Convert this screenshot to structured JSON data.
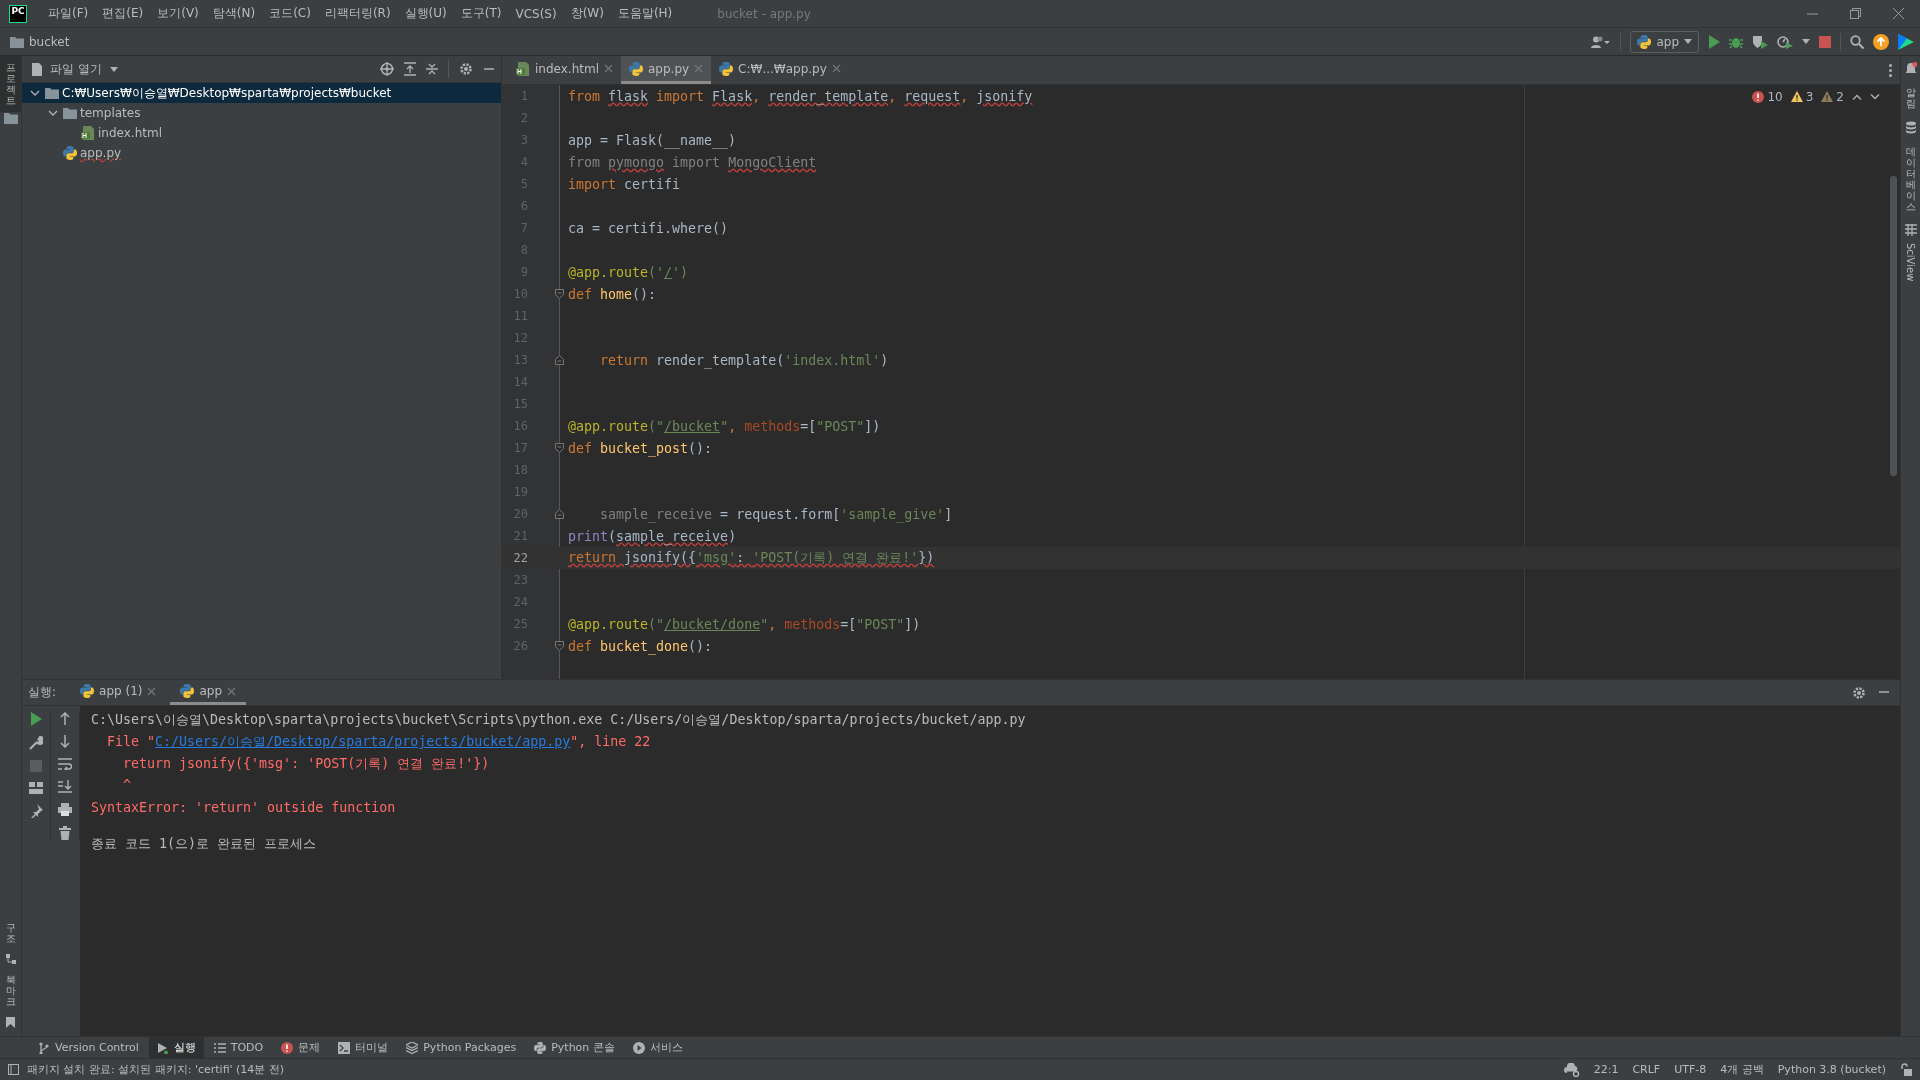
{
  "window": {
    "title": "bucket - app.py",
    "logo": "PC"
  },
  "menu": [
    "파일(F)",
    "편집(E)",
    "보기(V)",
    "탐색(N)",
    "코드(C)",
    "리팩터링(R)",
    "실행(U)",
    "도구(T)",
    "VCS(S)",
    "창(W)",
    "도움말(H)"
  ],
  "breadcrumb": "bucket",
  "run_config": "app",
  "left_strip": {
    "top": "프로젝트",
    "bottom": [
      "구조",
      "북마크"
    ]
  },
  "right_strip": [
    {
      "label": "알림",
      "kind": "bell"
    },
    {
      "label": "데이터베이스",
      "kind": "database"
    },
    {
      "label": "SciView",
      "kind": "grid"
    }
  ],
  "project": {
    "title": "파일 열기",
    "tree": [
      {
        "label": "C:₩Users₩이승열₩Desktop₩sparta₩projects₩bucket",
        "kind": "folder",
        "expanded": true,
        "selected": true,
        "children": [
          {
            "label": "templates",
            "kind": "folder",
            "expanded": true,
            "selected": false,
            "children": [
              {
                "label": "index.html",
                "kind": "html",
                "selected": false
              }
            ]
          },
          {
            "label": "app.py",
            "kind": "python",
            "selected": false
          }
        ]
      }
    ]
  },
  "editor": {
    "tabs": [
      {
        "label": "index.html",
        "kind": "html",
        "selected": false
      },
      {
        "label": "app.py",
        "kind": "python",
        "selected": true
      },
      {
        "label": "C:₩...₩app.py",
        "kind": "python",
        "selected": false
      }
    ],
    "inspections": [
      {
        "kind": "error",
        "count": "10"
      },
      {
        "kind": "warning",
        "count": "3"
      },
      {
        "kind": "weak_warning",
        "count": "2"
      }
    ],
    "lines": [
      {
        "number": "1",
        "current": false,
        "kind": "code",
        "tokens": [
          {
            "text": "from ",
            "kind": "keyword"
          },
          {
            "text": "flask",
            "kind": "plain",
            "error": true
          },
          {
            "text": " import ",
            "kind": "keyword"
          },
          {
            "text": "Flask",
            "kind": "plain",
            "error": true
          },
          {
            "text": ", ",
            "kind": "keyword"
          },
          {
            "text": "render_template",
            "kind": "plain",
            "error": true
          },
          {
            "text": ", ",
            "kind": "keyword"
          },
          {
            "text": "request",
            "kind": "plain",
            "error": true
          },
          {
            "text": ", ",
            "kind": "keyword"
          },
          {
            "text": "jsonify",
            "kind": "plain",
            "error": true
          }
        ]
      },
      {
        "number": "2",
        "current": false,
        "kind": "code"
      },
      {
        "number": "3",
        "current": false,
        "kind": "code",
        "tokens": [
          {
            "text": "app = Flask(__name__)",
            "kind": "plain"
          }
        ]
      },
      {
        "number": "4",
        "current": false,
        "kind": "code",
        "tokens": [
          {
            "text": "from ",
            "kind": "unused"
          },
          {
            "text": "pymongo",
            "kind": "unused",
            "error": true
          },
          {
            "text": " import ",
            "kind": "unused"
          },
          {
            "text": "MongoClient",
            "kind": "unused",
            "error": true
          }
        ]
      },
      {
        "number": "5",
        "current": false,
        "kind": "code",
        "tokens": [
          {
            "text": "import",
            "kind": "keyword"
          },
          {
            "text": " certifi",
            "kind": "plain"
          }
        ]
      },
      {
        "number": "6",
        "current": false,
        "kind": "code"
      },
      {
        "number": "7",
        "current": false,
        "kind": "code",
        "tokens": [
          {
            "text": "ca = certifi.where()",
            "kind": "plain"
          }
        ]
      },
      {
        "number": "8",
        "current": false,
        "kind": "code"
      },
      {
        "number": "9",
        "current": false,
        "kind": "code",
        "tokens": [
          {
            "text": "@app.route",
            "kind": "decorator"
          },
          {
            "text": "('",
            "kind": "string"
          },
          {
            "text": "/",
            "kind": "string",
            "link": true
          },
          {
            "text": "')",
            "kind": "string"
          }
        ]
      },
      {
        "number": "10",
        "current": false,
        "kind": "fold_start",
        "tokens": [
          {
            "text": "def ",
            "kind": "keyword"
          },
          {
            "text": "home",
            "kind": "function"
          },
          {
            "text": "():",
            "kind": "plain"
          }
        ]
      },
      {
        "number": "11",
        "current": false,
        "kind": "code"
      },
      {
        "number": "12",
        "current": false,
        "kind": "code"
      },
      {
        "number": "13",
        "current": false,
        "kind": "fold_end",
        "tokens": [
          {
            "text": "    return",
            "kind": "keyword"
          },
          {
            "text": " render_template(",
            "kind": "plain"
          },
          {
            "text": "'index.html'",
            "kind": "string"
          },
          {
            "text": ")",
            "kind": "plain"
          }
        ]
      },
      {
        "number": "14",
        "current": false,
        "kind": "code"
      },
      {
        "number": "15",
        "current": false,
        "kind": "code"
      },
      {
        "number": "16",
        "current": false,
        "kind": "code",
        "tokens": [
          {
            "text": "@app.route",
            "kind": "decorator"
          },
          {
            "text": "(\"",
            "kind": "string"
          },
          {
            "text": "/bucket",
            "kind": "string",
            "link": true
          },
          {
            "text": "\"",
            "kind": "string"
          },
          {
            "text": ", ",
            "kind": "keyword"
          },
          {
            "text": "methods",
            "kind": "param"
          },
          {
            "text": "=[",
            "kind": "plain"
          },
          {
            "text": "\"POST\"",
            "kind": "string"
          },
          {
            "text": "])",
            "kind": "plain"
          }
        ]
      },
      {
        "number": "17",
        "current": false,
        "kind": "fold_start",
        "tokens": [
          {
            "text": "def ",
            "kind": "keyword"
          },
          {
            "text": "bucket_post",
            "kind": "function"
          },
          {
            "text": "():",
            "kind": "plain"
          }
        ]
      },
      {
        "number": "18",
        "current": false,
        "kind": "code"
      },
      {
        "number": "19",
        "current": false,
        "kind": "code"
      },
      {
        "number": "20",
        "current": false,
        "kind": "fold_end",
        "tokens": [
          {
            "text": "    sample_receive",
            "kind": "unused"
          },
          {
            "text": " = request.form[",
            "kind": "plain"
          },
          {
            "text": "'sample_give'",
            "kind": "string"
          },
          {
            "text": "]",
            "kind": "plain"
          }
        ]
      },
      {
        "number": "21",
        "current": false,
        "kind": "code",
        "tokens": [
          {
            "text": "print",
            "kind": "builtin"
          },
          {
            "text": "(",
            "kind": "plain"
          },
          {
            "text": "sample_receive",
            "kind": "plain",
            "error": true
          },
          {
            "text": ")",
            "kind": "plain"
          }
        ]
      },
      {
        "number": "22",
        "current": true,
        "kind": "code",
        "tokens": [
          {
            "text": "return",
            "kind": "keyword",
            "error": true
          },
          {
            "text": " jsonify({",
            "kind": "plain",
            "error": true
          },
          {
            "text": "'msg'",
            "kind": "string",
            "error": true
          },
          {
            "text": ": ",
            "kind": "plain",
            "error": true
          },
          {
            "text": "'POST(기록) 연결 완료!'",
            "kind": "string",
            "error": true
          },
          {
            "text": "})",
            "kind": "plain",
            "error": true
          }
        ]
      },
      {
        "number": "23",
        "current": false,
        "kind": "code"
      },
      {
        "number": "24",
        "current": false,
        "kind": "code"
      },
      {
        "number": "25",
        "current": false,
        "kind": "code",
        "tokens": [
          {
            "text": "@app.route",
            "kind": "decorator"
          },
          {
            "text": "(\"",
            "kind": "string"
          },
          {
            "text": "/bucket/done",
            "kind": "string",
            "link": true
          },
          {
            "text": "\"",
            "kind": "string"
          },
          {
            "text": ", ",
            "kind": "keyword"
          },
          {
            "text": "methods",
            "kind": "param"
          },
          {
            "text": "=[",
            "kind": "plain"
          },
          {
            "text": "\"POST\"",
            "kind": "string"
          },
          {
            "text": "])",
            "kind": "plain"
          }
        ]
      },
      {
        "number": "26",
        "current": false,
        "kind": "fold_start",
        "tokens": [
          {
            "text": "def ",
            "kind": "keyword"
          },
          {
            "text": "bucket_done",
            "kind": "function"
          },
          {
            "text": "():",
            "kind": "plain"
          }
        ]
      }
    ]
  },
  "run": {
    "label": "실행:",
    "tabs": [
      {
        "label": "app (1)",
        "selected": false
      },
      {
        "label": "app",
        "selected": true
      }
    ],
    "output": [
      {
        "kind": "plain",
        "parts": [
          {
            "text": "C:\\Users\\이승열\\Desktop\\sparta\\projects\\bucket\\Scripts\\python.exe C:/Users/이승열/Desktop/sparta/projects/bucket/app.py",
            "link": false
          }
        ]
      },
      {
        "kind": "trace_file",
        "parts": [
          {
            "text": "File \"",
            "link": false
          },
          {
            "text": "C:/Users/이승열/Desktop/sparta/projects/bucket/app.py",
            "link": true
          },
          {
            "text": "\", line 22",
            "link": false
          }
        ]
      },
      {
        "kind": "trace_code",
        "parts": [
          {
            "text": "return jsonify({'msg': 'POST(기록) 연결 완료!'})",
            "link": false
          }
        ]
      },
      {
        "kind": "trace_code",
        "parts": [
          {
            "text": "^",
            "link": false
          }
        ]
      },
      {
        "kind": "error",
        "parts": [
          {
            "text": "SyntaxError: 'return' outside function",
            "link": false
          }
        ]
      },
      {
        "kind": "exit",
        "parts": [
          {
            "text": "종료 코드 1(으)로 완료된 프로세스",
            "link": false
          }
        ]
      }
    ]
  },
  "tool_tabs": [
    {
      "label": "Version Control",
      "kind": "vcs",
      "selected": false
    },
    {
      "label": "실행",
      "kind": "run",
      "selected": true
    },
    {
      "label": "TODO",
      "kind": "todo",
      "selected": false
    },
    {
      "label": "문제",
      "kind": "problems",
      "selected": false
    },
    {
      "label": "터미널",
      "kind": "terminal",
      "selected": false
    },
    {
      "label": "Python Packages",
      "kind": "packages",
      "selected": false
    },
    {
      "label": "Python 콘솔",
      "kind": "console",
      "selected": false
    },
    {
      "label": "서비스",
      "kind": "services",
      "selected": false
    }
  ],
  "status": {
    "message": "패키지 설치 완료: 설치된 패키지: 'certifi' (14분 전)",
    "items": [
      "22:1",
      "CRLF",
      "UTF-8",
      "4개 공백",
      "Python 3.8 (bucket)"
    ]
  }
}
